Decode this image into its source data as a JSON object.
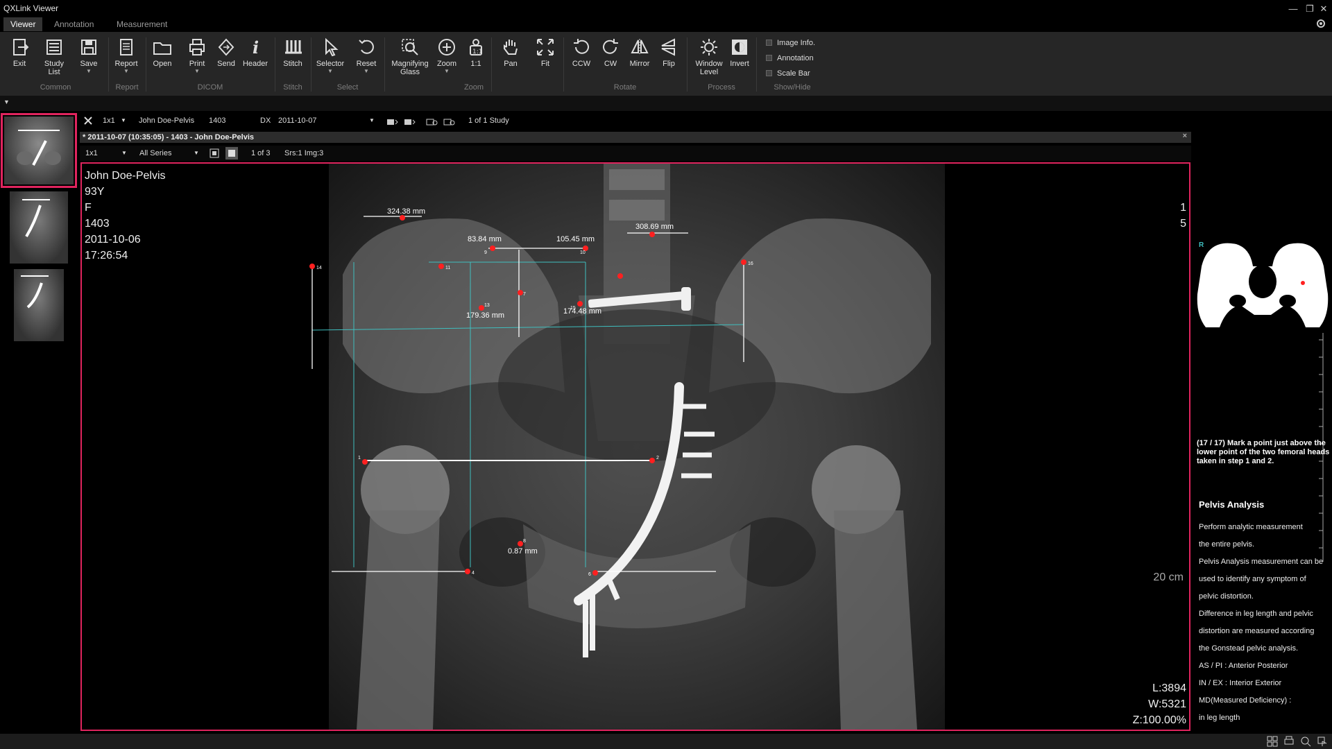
{
  "app": {
    "title": "QXLink Viewer"
  },
  "window_controls": {
    "minimize": "—",
    "restore": "❐",
    "close": "✕"
  },
  "tabs": [
    {
      "label": "Viewer",
      "active": true
    },
    {
      "label": "Annotation",
      "active": false
    },
    {
      "label": "Measurement",
      "active": false
    }
  ],
  "toolbar": {
    "buttons": [
      {
        "id": "exit",
        "label": "Exit",
        "icon": "exit-icon"
      },
      {
        "id": "study_list",
        "label": "Study\nList",
        "icon": "study-list-icon"
      },
      {
        "id": "save",
        "label": "Save",
        "icon": "save-icon",
        "dropdown": true
      },
      {
        "id": "report",
        "label": "Report",
        "icon": "report-icon",
        "dropdown": true
      },
      {
        "id": "open",
        "label": "Open",
        "icon": "folder-icon"
      },
      {
        "id": "print",
        "label": "Print",
        "icon": "printer-icon",
        "dropdown": true
      },
      {
        "id": "send",
        "label": "Send",
        "icon": "send-icon"
      },
      {
        "id": "header",
        "label": "Header",
        "icon": "info-icon"
      },
      {
        "id": "stitch",
        "label": "Stitch",
        "icon": "stitch-icon"
      },
      {
        "id": "selector",
        "label": "Selector",
        "icon": "cursor-icon",
        "dropdown": true
      },
      {
        "id": "reset",
        "label": "Reset",
        "icon": "reset-icon",
        "dropdown": true
      },
      {
        "id": "magnifying_glass",
        "label": "Magnifying\nGlass",
        "icon": "magnifying-glass-icon"
      },
      {
        "id": "zoom",
        "label": "Zoom",
        "icon": "zoom-icon",
        "dropdown": true
      },
      {
        "id": "one_to_one",
        "label": "1:1",
        "icon": "one-to-one-icon"
      },
      {
        "id": "pan",
        "label": "Pan",
        "icon": "hand-icon"
      },
      {
        "id": "fit",
        "label": "Fit",
        "icon": "fit-icon"
      },
      {
        "id": "ccw",
        "label": "CCW",
        "icon": "rotate-ccw-icon"
      },
      {
        "id": "cw",
        "label": "CW",
        "icon": "rotate-cw-icon"
      },
      {
        "id": "mirror",
        "label": "Mirror",
        "icon": "mirror-icon"
      },
      {
        "id": "flip",
        "label": "Flip",
        "icon": "flip-icon"
      },
      {
        "id": "window_level",
        "label": "Window\nLevel",
        "icon": "brightness-icon"
      },
      {
        "id": "invert",
        "label": "Invert",
        "icon": "invert-icon"
      }
    ],
    "groups": [
      {
        "label": "Common"
      },
      {
        "label": "Report"
      },
      {
        "label": "DICOM"
      },
      {
        "label": "Stitch"
      },
      {
        "label": "Select"
      },
      {
        "label": "Zoom"
      },
      {
        "label": "Rotate"
      },
      {
        "label": "Process"
      },
      {
        "label": "Show/Hide"
      }
    ],
    "show_hide": [
      {
        "label": "Image Info.",
        "checked": false
      },
      {
        "label": "Annotation",
        "checked": false
      },
      {
        "label": "Scale Bar",
        "checked": false
      }
    ]
  },
  "study_bar": {
    "layout": "1x1",
    "patient": "John Doe-Pelvis",
    "id": "1403",
    "modality": "DX",
    "date": "2011-10-07",
    "count": "1 of 1 Study"
  },
  "series_header": {
    "title": "* 2011-10-07 (10:35:05) - 1403 - John Doe-Pelvis",
    "close": "×"
  },
  "series_bar": {
    "layout": "1x1",
    "filter": "All Series",
    "page": "1 of 3",
    "info": "Srs:1 Img:3"
  },
  "overlay": {
    "top_left": [
      "John Doe-Pelvis",
      "93Y",
      "F",
      "1403",
      "2011-10-06",
      "17:26:54"
    ],
    "top_right": [
      "1",
      "5"
    ],
    "scale": "20 cm",
    "bottom_right": [
      "L:3894",
      "W:5321",
      "Z:100.00%"
    ]
  },
  "measurements": [
    {
      "label": "324.38 mm"
    },
    {
      "label": "83.84 mm"
    },
    {
      "label": "105.45 mm"
    },
    {
      "label": "308.69 mm"
    },
    {
      "label": "179.36 mm"
    },
    {
      "label": "174.48 mm"
    },
    {
      "label": "0.87 mm"
    }
  ],
  "points": [
    "1",
    "2",
    "4",
    "6",
    "7",
    "8",
    "9",
    "10",
    "11",
    "13",
    "14",
    "15",
    "16"
  ],
  "right_panel": {
    "diagram_side_label": "R",
    "step_text": "(17 / 17) Mark a point just above the lower point of the two femoral heads taken in step 1 and 2.",
    "title": "Pelvis Analysis",
    "description": [
      "Perform analytic measurement",
      "the entire pelvis.",
      "Pelvis Analysis measurement can be",
      "used to identify any symptom of",
      "pelvic distortion.",
      "Difference in leg length and pelvic",
      "distortion are measured according",
      "the Gonstead pelvic analysis.",
      "AS / PI : Anterior Posterior",
      "IN / EX : Interior Exterior",
      "MD(Measured Deficiency) :",
      "in leg length"
    ]
  },
  "colors": {
    "accent": "#e0245e",
    "marker": "#ff2020",
    "guide": "#3fbfbf"
  }
}
